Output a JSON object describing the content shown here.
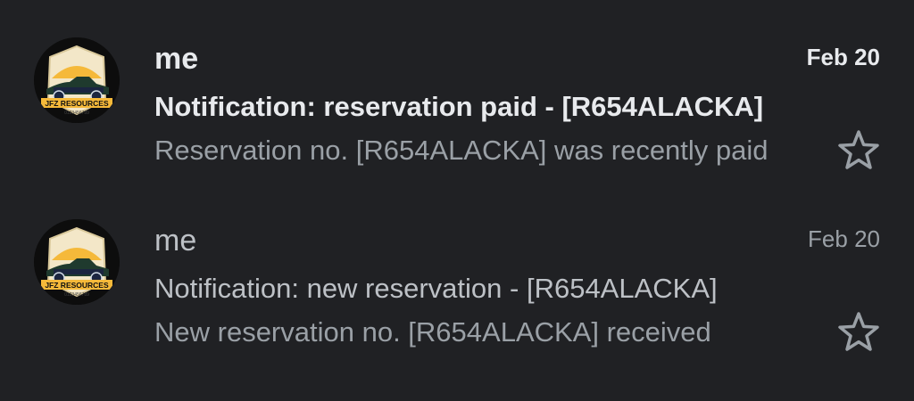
{
  "emails": [
    {
      "sender": "me",
      "date": "Feb 20",
      "subject": "Notification: reservation paid - [R654ALACKA]",
      "snippet": "Reservation no. [R654ALACKA] was recently paid",
      "unread": true,
      "starred": false
    },
    {
      "sender": "me",
      "date": "Feb 20",
      "subject": "Notification: new reservation - [R654ALACKA]",
      "snippet": "New reservation no. [R654ALACKA] received",
      "unread": false,
      "starred": false
    }
  ],
  "avatar": {
    "logo_text": "JFZ RESOURCES",
    "logo_subtext": "0123456789"
  },
  "colors": {
    "background": "#202124",
    "text_primary": "#e8eaed",
    "text_secondary": "#9aa0a6",
    "logo_sun": "#f5b93a",
    "logo_car": "#1f3a2e"
  },
  "icons": {
    "star": "star-outline-icon",
    "avatar": "jfz-resources-logo"
  }
}
